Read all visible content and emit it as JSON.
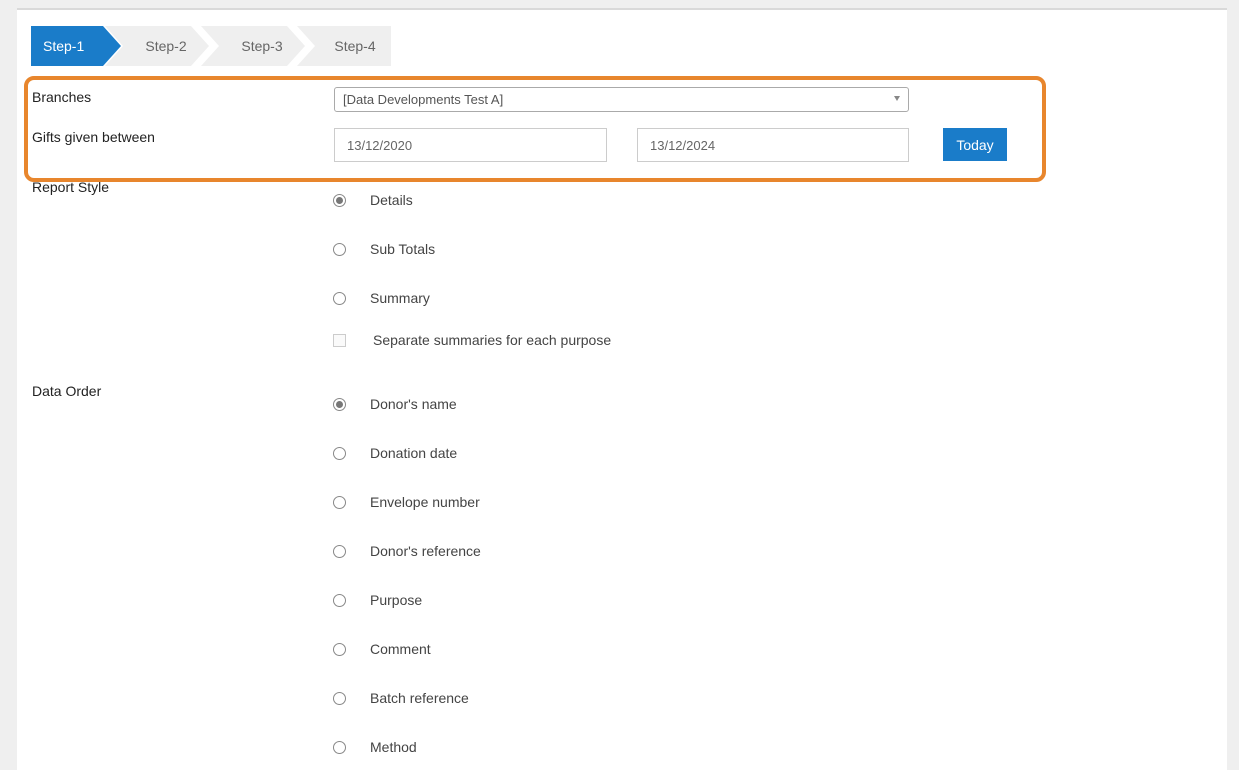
{
  "steps": [
    "Step-1",
    "Step-2",
    "Step-3",
    "Step-4"
  ],
  "filters": {
    "branches_label": "Branches",
    "branches_value": "[Data Developments Test A]",
    "gifts_label": "Gifts given between",
    "date_from": "13/12/2020",
    "date_to": "13/12/2024",
    "today_label": "Today"
  },
  "report_style": {
    "label": "Report Style",
    "options": [
      "Details",
      "Sub Totals",
      "Summary"
    ],
    "selected": "Details",
    "separate_label": "Separate summaries for each purpose"
  },
  "data_order": {
    "label": "Data Order",
    "options": [
      "Donor's name",
      "Donation date",
      "Envelope number",
      "Donor's reference",
      "Purpose",
      "Comment",
      "Batch reference",
      "Method"
    ],
    "selected": "Donor's name"
  },
  "colors": {
    "primary": "#1a7cc9",
    "highlight": "#e8862d"
  }
}
